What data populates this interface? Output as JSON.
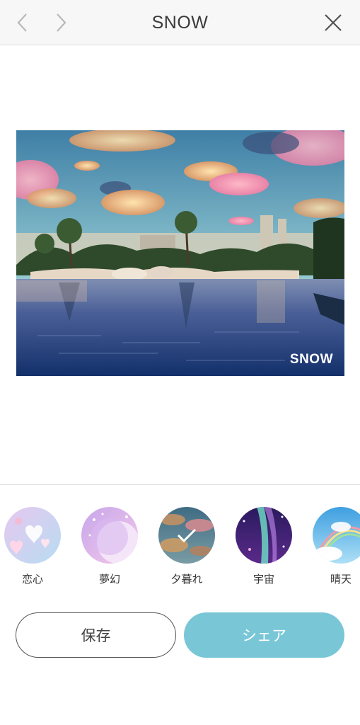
{
  "header": {
    "title": "SNOW"
  },
  "photo": {
    "watermark": "SNOW"
  },
  "filters": [
    {
      "label": "恋心",
      "selected": false
    },
    {
      "label": "夢幻",
      "selected": false
    },
    {
      "label": "夕暮れ",
      "selected": true
    },
    {
      "label": "宇宙",
      "selected": false
    },
    {
      "label": "晴天",
      "selected": false
    }
  ],
  "actions": {
    "save_label": "保存",
    "share_label": "シェア"
  },
  "colors": {
    "accent": "#78c6d6",
    "navbar": "#f7f7f7"
  }
}
